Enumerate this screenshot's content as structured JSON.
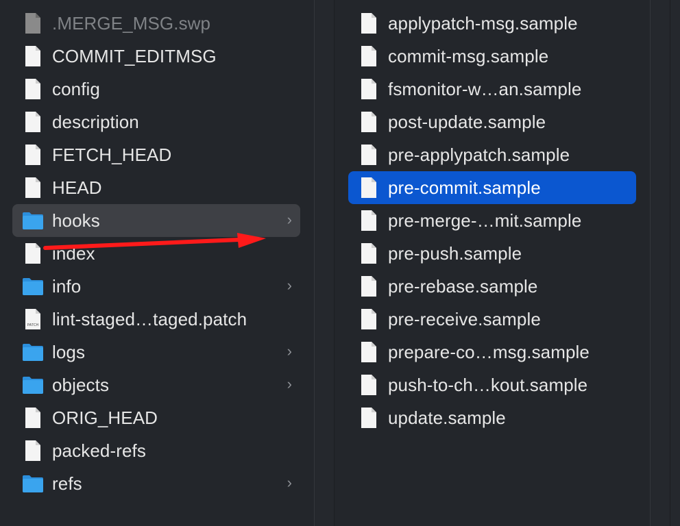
{
  "window": {
    "title": ""
  },
  "left_column": {
    "items": [
      {
        "label": ".MERGE_MSG.swp",
        "kind": "file-dim",
        "has_chevron": false
      },
      {
        "label": "COMMIT_EDITMSG",
        "kind": "file",
        "has_chevron": false
      },
      {
        "label": "config",
        "kind": "file",
        "has_chevron": false
      },
      {
        "label": "description",
        "kind": "file",
        "has_chevron": false
      },
      {
        "label": "FETCH_HEAD",
        "kind": "file",
        "has_chevron": false
      },
      {
        "label": "HEAD",
        "kind": "file",
        "has_chevron": false
      },
      {
        "label": "hooks",
        "kind": "folder",
        "has_chevron": true,
        "state": "hover"
      },
      {
        "label": "index",
        "kind": "file",
        "has_chevron": false
      },
      {
        "label": "info",
        "kind": "folder",
        "has_chevron": true
      },
      {
        "label": "lint-staged…taged.patch",
        "kind": "patch",
        "has_chevron": false,
        "icon_text": "PATCH"
      },
      {
        "label": "logs",
        "kind": "folder",
        "has_chevron": true
      },
      {
        "label": "objects",
        "kind": "folder",
        "has_chevron": true
      },
      {
        "label": "ORIG_HEAD",
        "kind": "file",
        "has_chevron": false
      },
      {
        "label": "packed-refs",
        "kind": "file",
        "has_chevron": false
      },
      {
        "label": "refs",
        "kind": "folder",
        "has_chevron": true
      }
    ],
    "chevron": "›"
  },
  "right_column": {
    "items": [
      {
        "label": "applypatch-msg.sample"
      },
      {
        "label": "commit-msg.sample"
      },
      {
        "label": "fsmonitor-w…an.sample"
      },
      {
        "label": "post-update.sample"
      },
      {
        "label": "pre-applypatch.sample"
      },
      {
        "label": "pre-commit.sample",
        "state": "selected"
      },
      {
        "label": "pre-merge-…mit.sample"
      },
      {
        "label": "pre-push.sample"
      },
      {
        "label": "pre-rebase.sample"
      },
      {
        "label": "pre-receive.sample"
      },
      {
        "label": "prepare-co…msg.sample"
      },
      {
        "label": "push-to-ch…kout.sample"
      },
      {
        "label": "update.sample"
      }
    ]
  },
  "colors": {
    "background": "#23262b",
    "hover": "#3e4045",
    "selected": "#0b57d0",
    "folder": "#3aa4ee",
    "annotation_arrow": "#ff1a1a"
  },
  "annotation": {
    "type": "arrow",
    "icon": "red-arrow-icon",
    "from": "hooks",
    "to": "right_column"
  }
}
